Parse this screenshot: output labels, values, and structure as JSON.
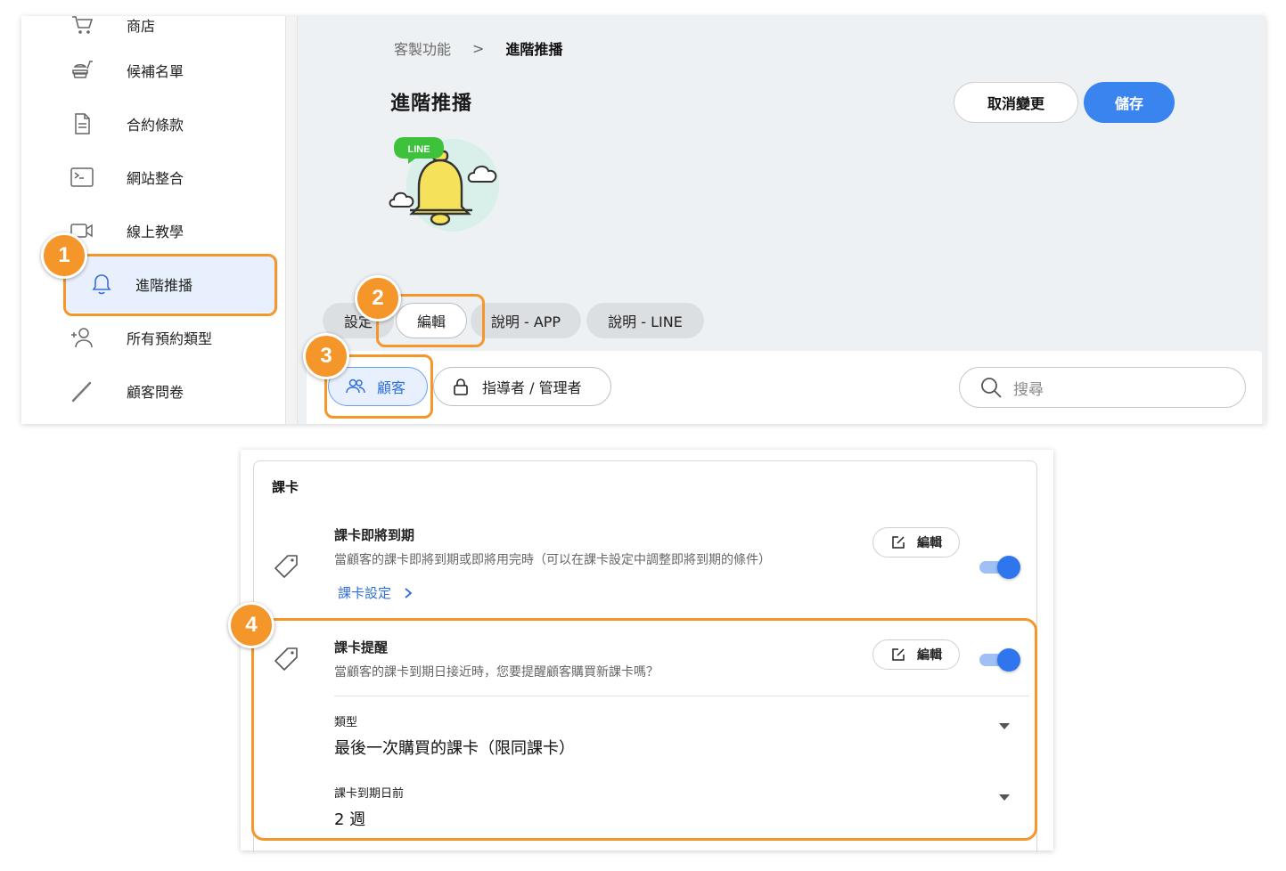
{
  "sidebar": {
    "items": [
      {
        "label": "商店",
        "icon": "cart-icon"
      },
      {
        "label": "候補名單",
        "icon": "food-icon"
      },
      {
        "label": "合約條款",
        "icon": "document-icon"
      },
      {
        "label": "網站整合",
        "icon": "terminal-icon"
      },
      {
        "label": "線上教學",
        "icon": "video-icon"
      },
      {
        "label": "進階推播",
        "icon": "bell-icon",
        "active": true
      },
      {
        "label": "所有預約類型",
        "icon": "add-user-icon"
      },
      {
        "label": "顧客問卷",
        "icon": "pencil-icon"
      }
    ]
  },
  "header": {
    "breadcrumb_parent": "客製功能",
    "breadcrumb_separator": ">",
    "breadcrumb_current": "進階推播",
    "title": "進階推播",
    "cancel_label": "取消變更",
    "save_label": "儲存",
    "hero_badge": "LINE"
  },
  "tabs": [
    {
      "label": "設定"
    },
    {
      "label": "編輯",
      "active": true
    },
    {
      "label": "說明 - APP"
    },
    {
      "label": "說明 - LINE"
    }
  ],
  "audience": {
    "customer_label": "顧客",
    "staff_label": "指導者 / 管理者",
    "search_placeholder": "搜尋"
  },
  "card": {
    "section_title": "課卡",
    "items": [
      {
        "title": "課卡即將到期",
        "desc": "當顧客的課卡即將到期或即將用完時（可以在課卡設定中調整即將到期的條件）",
        "link": "課卡設定",
        "edit_label": "編輯",
        "enabled": true
      },
      {
        "title": "課卡提醒",
        "desc": "當顧客的課卡到期日接近時，您要提醒顧客購買新課卡嗎？",
        "edit_label": "編輯",
        "enabled": true
      }
    ],
    "fields": [
      {
        "label": "類型",
        "value": "最後一次購買的課卡（限同課卡）"
      },
      {
        "label": "課卡到期日前",
        "value": "2 週"
      }
    ]
  },
  "annotations": [
    "1",
    "2",
    "3",
    "4"
  ],
  "colors": {
    "accent": "#3a84f0",
    "highlight": "#f5962b",
    "toggle_on": "#2f76ee"
  }
}
